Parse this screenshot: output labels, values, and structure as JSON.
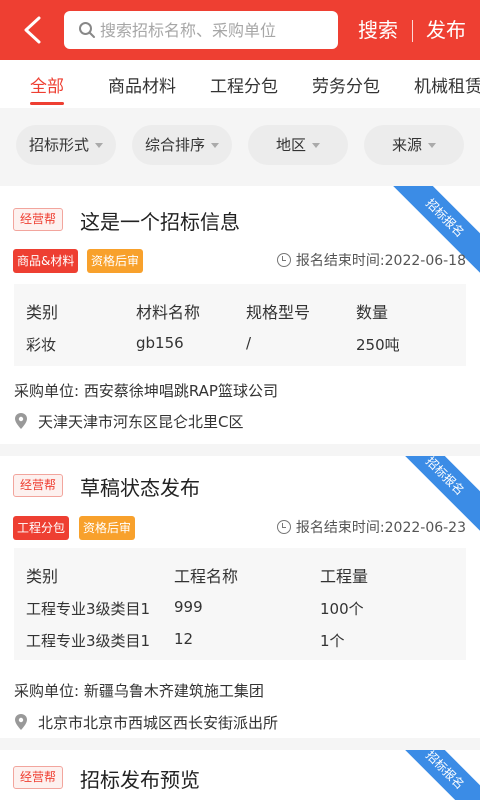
{
  "header": {
    "search_placeholder": "搜索招标名称、采购单位",
    "search_label": "搜索",
    "publish_label": "发布"
  },
  "tabs": [
    "全部",
    "商品材料",
    "工程分包",
    "劳务分包",
    "机械租赁"
  ],
  "filters": [
    "招标形式",
    "综合排序",
    "地区",
    "来源"
  ],
  "cards": [
    {
      "badge": "经营帮",
      "title": "这是一个招标信息",
      "ribbon": "招标报名",
      "tags": [
        "商品&材料",
        "资格后审"
      ],
      "deadline": "报名结束时间:2022-06-18",
      "table_headers": [
        "类别",
        "材料名称",
        "规格型号",
        "数量"
      ],
      "table_rows": [
        [
          "彩妆",
          "gb156",
          "/",
          "250吨"
        ]
      ],
      "buyer": "采购单位: 西安蔡徐坤唱跳RAP篮球公司",
      "address": "天津天津市河东区昆仑北里C区"
    },
    {
      "badge": "经营帮",
      "title": "草稿状态发布",
      "ribbon": "招标报名",
      "tags": [
        "工程分包",
        "资格后审"
      ],
      "deadline": "报名结束时间:2022-06-23",
      "table_headers": [
        "类别",
        "工程名称",
        "工程量"
      ],
      "table_rows": [
        [
          "工程专业3级类目1",
          "999",
          "100个"
        ],
        [
          "工程专业3级类目1",
          "12",
          "1个"
        ]
      ],
      "buyer": "采购单位: 新疆乌鲁木齐建筑施工集团",
      "address": "北京市北京市西城区西长安街派出所"
    },
    {
      "badge": "经营帮",
      "title": "招标发布预览",
      "ribbon": "招标报名"
    }
  ]
}
